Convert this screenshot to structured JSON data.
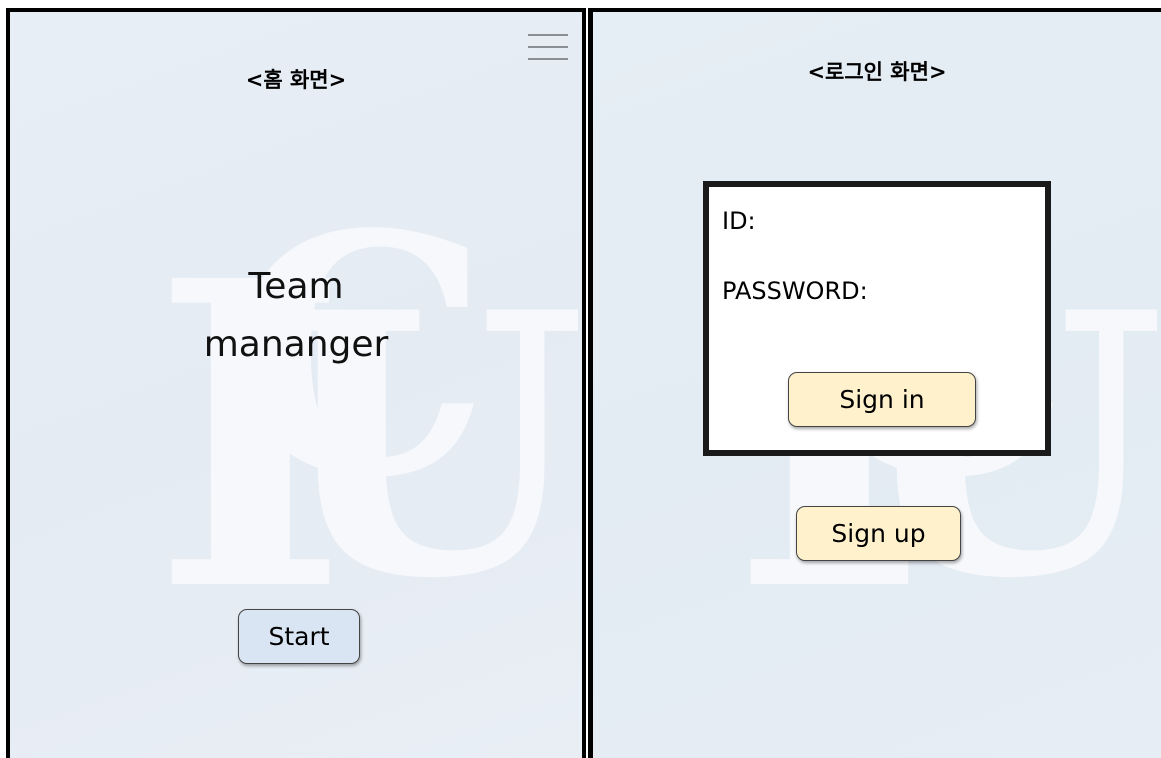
{
  "home_screen": {
    "title": "<홈 화면>",
    "app_name_line1": "Team",
    "app_name_line2": "mananger",
    "start_button": "Start",
    "menu_icon": "hamburger-menu-icon"
  },
  "login_screen": {
    "title": "<로그인 화면>",
    "id_label": "ID:",
    "password_label": "PASSWORD:",
    "signin_button": "Sign in",
    "signup_button": "Sign up"
  },
  "watermark": {
    "letters": [
      "I",
      "C",
      "U"
    ]
  },
  "colors": {
    "panel_background": "#e5ecf4",
    "start_button_bg": "#d9e5f3",
    "auth_button_bg": "#fff1cc",
    "login_box_bg": "#ffffff",
    "watermark": "#f6f8fb"
  }
}
